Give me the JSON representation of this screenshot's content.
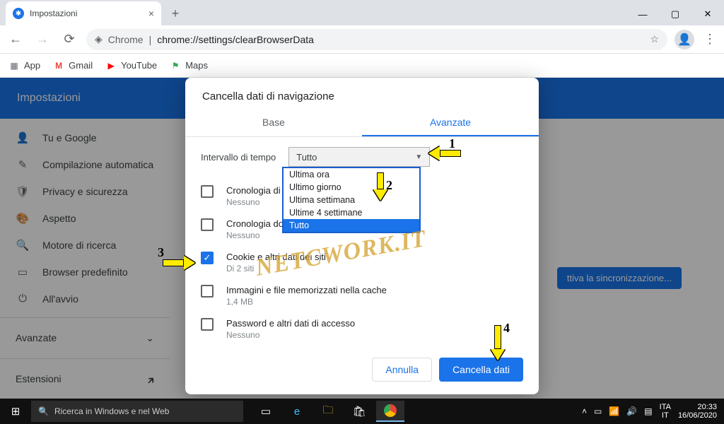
{
  "window": {
    "tab_title": "Impostazioni"
  },
  "toolbar": {
    "url_prefix": "Chrome",
    "url_sep": "|",
    "url": "chrome://settings/clearBrowserData"
  },
  "bookmarks": {
    "apps": "App",
    "gmail": "Gmail",
    "youtube": "YouTube",
    "maps": "Maps"
  },
  "settings": {
    "header": "Impostazioni",
    "sidebar": {
      "you": "Tu e Google",
      "autofill": "Compilazione automatica",
      "privacy": "Privacy e sicurezza",
      "appearance": "Aspetto",
      "search": "Motore di ricerca",
      "default_browser": "Browser predefinito",
      "startup": "All'avvio",
      "advanced": "Avanzate",
      "extensions": "Estensioni"
    },
    "sync_button": "ttiva la sincronizzazione..."
  },
  "dialog": {
    "title": "Cancella dati di navigazione",
    "tab_basic": "Base",
    "tab_advanced": "Avanzate",
    "interval_label": "Intervallo di tempo",
    "interval_value": "Tutto",
    "options": {
      "o1": "Ultima ora",
      "o2": "Ultimo giorno",
      "o3": "Ultima settimana",
      "o4": "Ultime 4 settimane",
      "o5": "Tutto"
    },
    "items": {
      "history": {
        "label": "Cronologia di n",
        "sub": "Nessuno"
      },
      "downloads": {
        "label": "Cronologia dow",
        "sub": "Nessuno"
      },
      "cookies": {
        "label": "Cookie e altri dati dei siti",
        "sub": "Di 2 siti"
      },
      "cache": {
        "label": "Immagini e file memorizzati nella cache",
        "sub": "1,4 MB"
      },
      "passwords": {
        "label": "Password e altri dati di accesso",
        "sub": "Nessuno"
      }
    },
    "cancel": "Annulla",
    "confirm": "Cancella dati"
  },
  "annotations": {
    "n1": "1",
    "n2": "2",
    "n3": "3",
    "n4": "4"
  },
  "watermark": "NETCWORK.IT",
  "taskbar": {
    "search_placeholder": "Ricerca in Windows e nel Web",
    "lang1": "ITA",
    "lang2": "IT",
    "time": "20:33",
    "date": "16/06/2020"
  }
}
